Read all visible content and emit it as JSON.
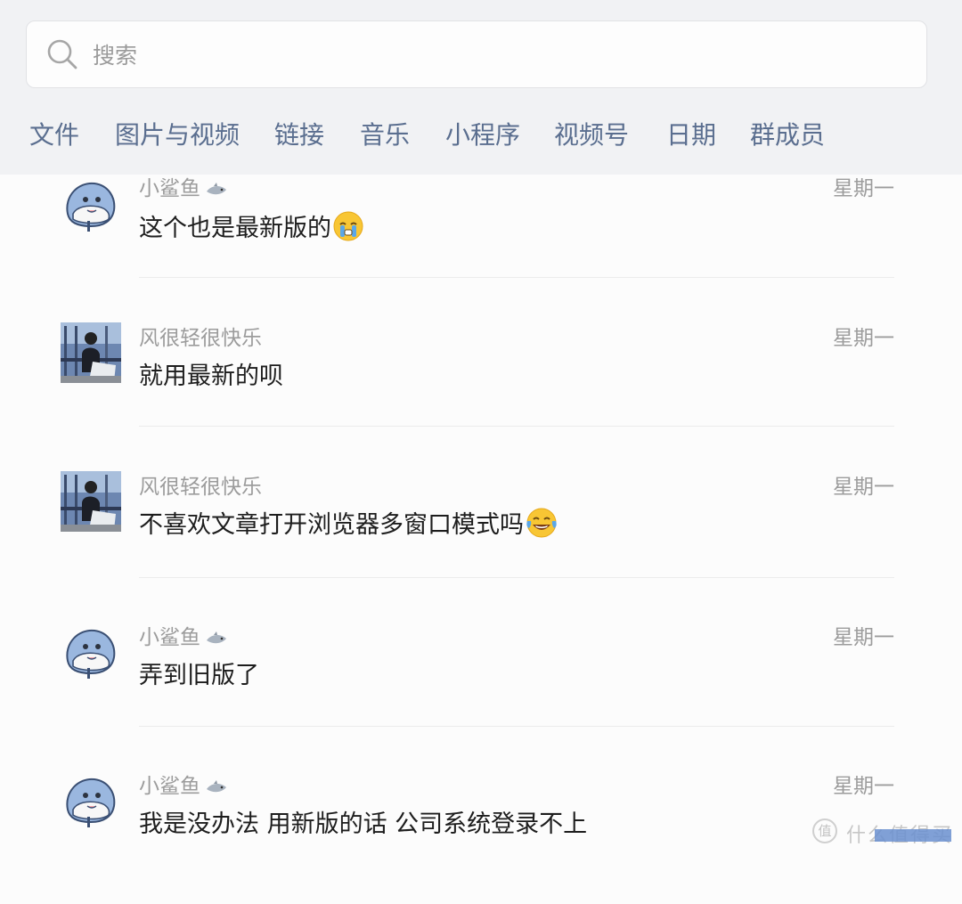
{
  "search": {
    "placeholder": "搜索",
    "value": ""
  },
  "filters": [
    "文件",
    "图片与视频",
    "链接",
    "音乐",
    "小程序",
    "视频号",
    "日期",
    "群成员"
  ],
  "results": [
    {
      "sender": "小鲨鱼",
      "time": "星期一",
      "message": "这个也是最新版的",
      "emoji": "crying-face-emoji",
      "avatar": "shark-avatar"
    },
    {
      "sender": "风很轻很快乐",
      "time": "星期一",
      "message": "就用最新的呗",
      "emoji": "",
      "avatar": "photo-avatar"
    },
    {
      "sender": "风很轻很快乐",
      "time": "星期一",
      "message": "不喜欢文章打开浏览器多窗口模式吗",
      "emoji": "tears-of-joy-emoji",
      "avatar": "photo-avatar"
    },
    {
      "sender": "小鲨鱼",
      "time": "星期一",
      "message": "弄到旧版了",
      "emoji": "",
      "avatar": "shark-avatar"
    },
    {
      "sender": "小鲨鱼",
      "time": "星期一",
      "message": "我是没办法  用新版的话  公司系统登录不上",
      "emoji": "",
      "avatar": "shark-avatar"
    }
  ],
  "watermark": {
    "logo": "值",
    "text": "什么值得买"
  },
  "colors": {
    "tab_text": "#5a6e8f",
    "panel_bg": "#f1f2f4",
    "meta_text": "#9c9c9c",
    "message_text": "#1d1d1d"
  }
}
